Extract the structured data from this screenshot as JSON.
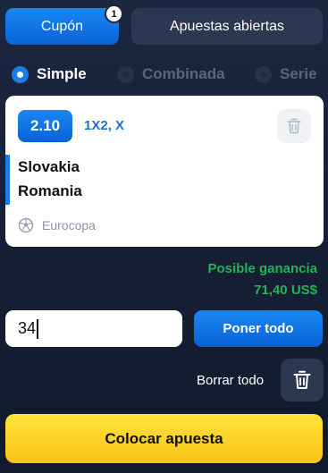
{
  "tabs": {
    "coupon_label": "Cupón",
    "coupon_badge": "1",
    "open_bets_label": "Apuestas abiertas"
  },
  "bet_types": [
    {
      "label": "Simple",
      "selected": true
    },
    {
      "label": "Combinada",
      "selected": false
    },
    {
      "label": "Serie",
      "selected": false
    }
  ],
  "selection": {
    "odds": "2.10",
    "market": "1X2, X",
    "team_home": "Slovakia",
    "team_away": "Romania",
    "league": "Eurocopa",
    "league_icon": "soccer-ball-icon",
    "remove_icon": "trash-icon"
  },
  "winnings": {
    "label": "Posible ganancia",
    "value": "71,40 US$"
  },
  "stake": {
    "value": "34"
  },
  "actions": {
    "max_label": "Poner todo",
    "clear_label": "Borrar todo",
    "clear_icon": "trash-icon",
    "place_label": "Colocar apuesta"
  },
  "colors": {
    "accent_blue": "#0a63d6",
    "win_green": "#22b357",
    "place_yellow": "#f8c417",
    "background": "#172036"
  }
}
